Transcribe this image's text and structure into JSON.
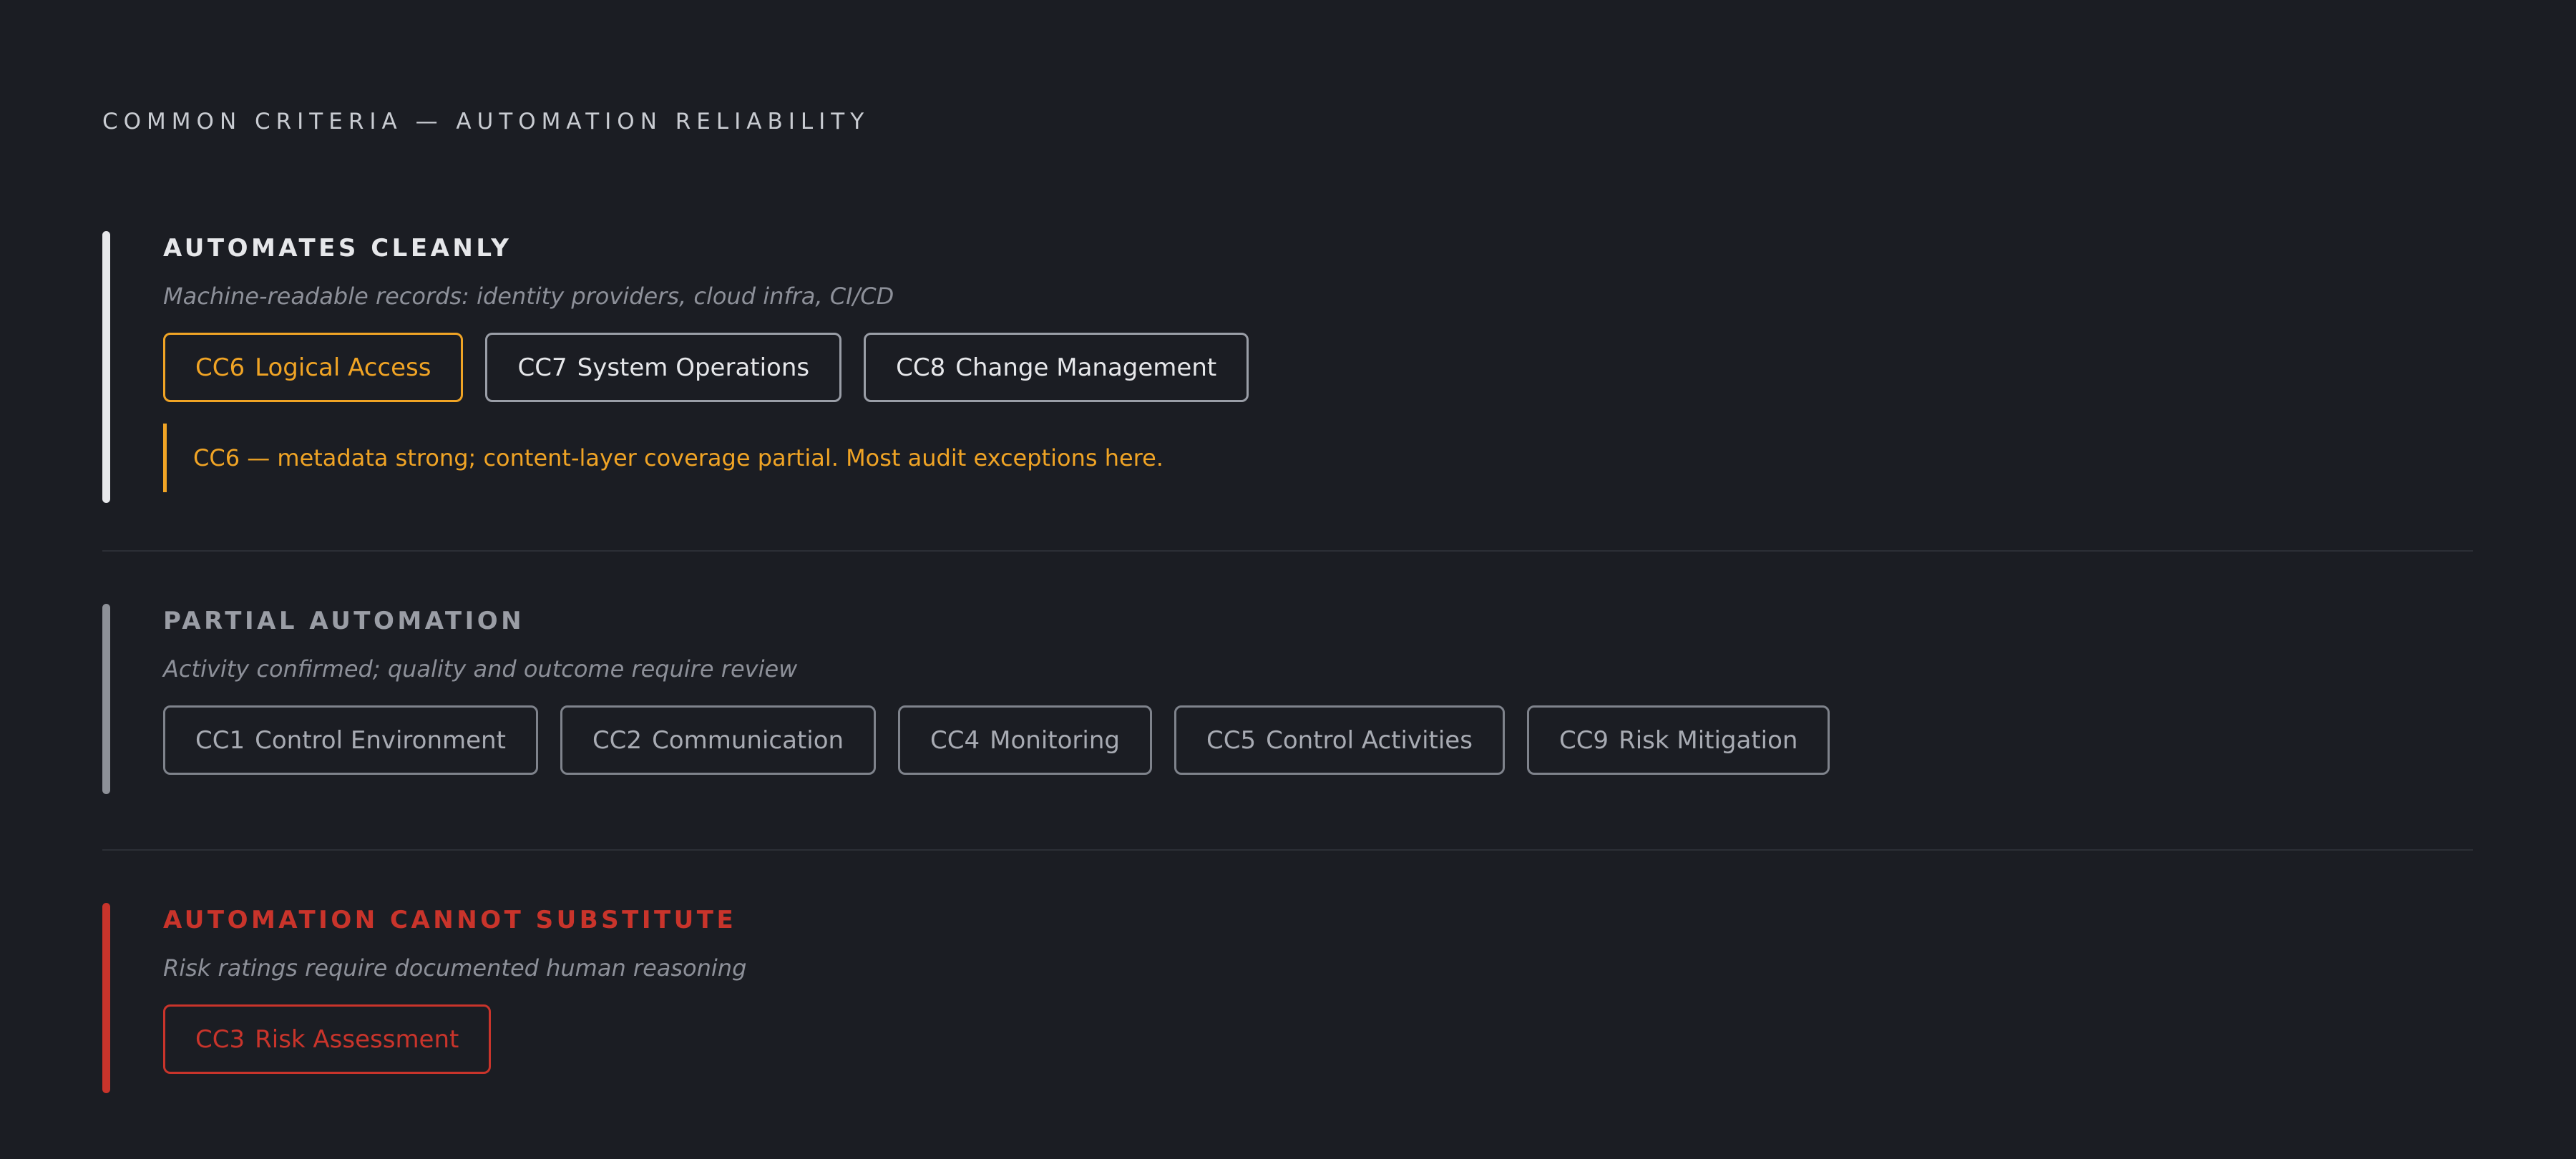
{
  "title": "COMMON CRITERIA — AUTOMATION RELIABILITY",
  "colors": {
    "background": "#1b1d23",
    "clean": "#e7e8eb",
    "partial": "#8e9198",
    "cannot": "#c9342b",
    "highlight": "#f0a425"
  },
  "sections": [
    {
      "title": "AUTOMATES CLEANLY",
      "subtitle": "Machine-readable records: identity providers, cloud infra, CI/CD",
      "chips": [
        {
          "code": "CC6",
          "label": "Logical Access",
          "selected": true
        },
        {
          "code": "CC7",
          "label": "System Operations",
          "selected": false
        },
        {
          "code": "CC8",
          "label": "Change Management",
          "selected": false
        }
      ],
      "note": "CC6 — metadata strong; content-layer coverage partial. Most audit exceptions here."
    },
    {
      "title": "PARTIAL AUTOMATION",
      "subtitle": "Activity confirmed; quality and outcome require review",
      "chips": [
        {
          "code": "CC1",
          "label": "Control Environment"
        },
        {
          "code": "CC2",
          "label": "Communication"
        },
        {
          "code": "CC4",
          "label": "Monitoring"
        },
        {
          "code": "CC5",
          "label": "Control Activities"
        },
        {
          "code": "CC9",
          "label": "Risk Mitigation"
        }
      ]
    },
    {
      "title": "AUTOMATION CANNOT SUBSTITUTE",
      "subtitle": "Risk ratings require documented human reasoning",
      "chips": [
        {
          "code": "CC3",
          "label": "Risk Assessment"
        }
      ]
    }
  ]
}
